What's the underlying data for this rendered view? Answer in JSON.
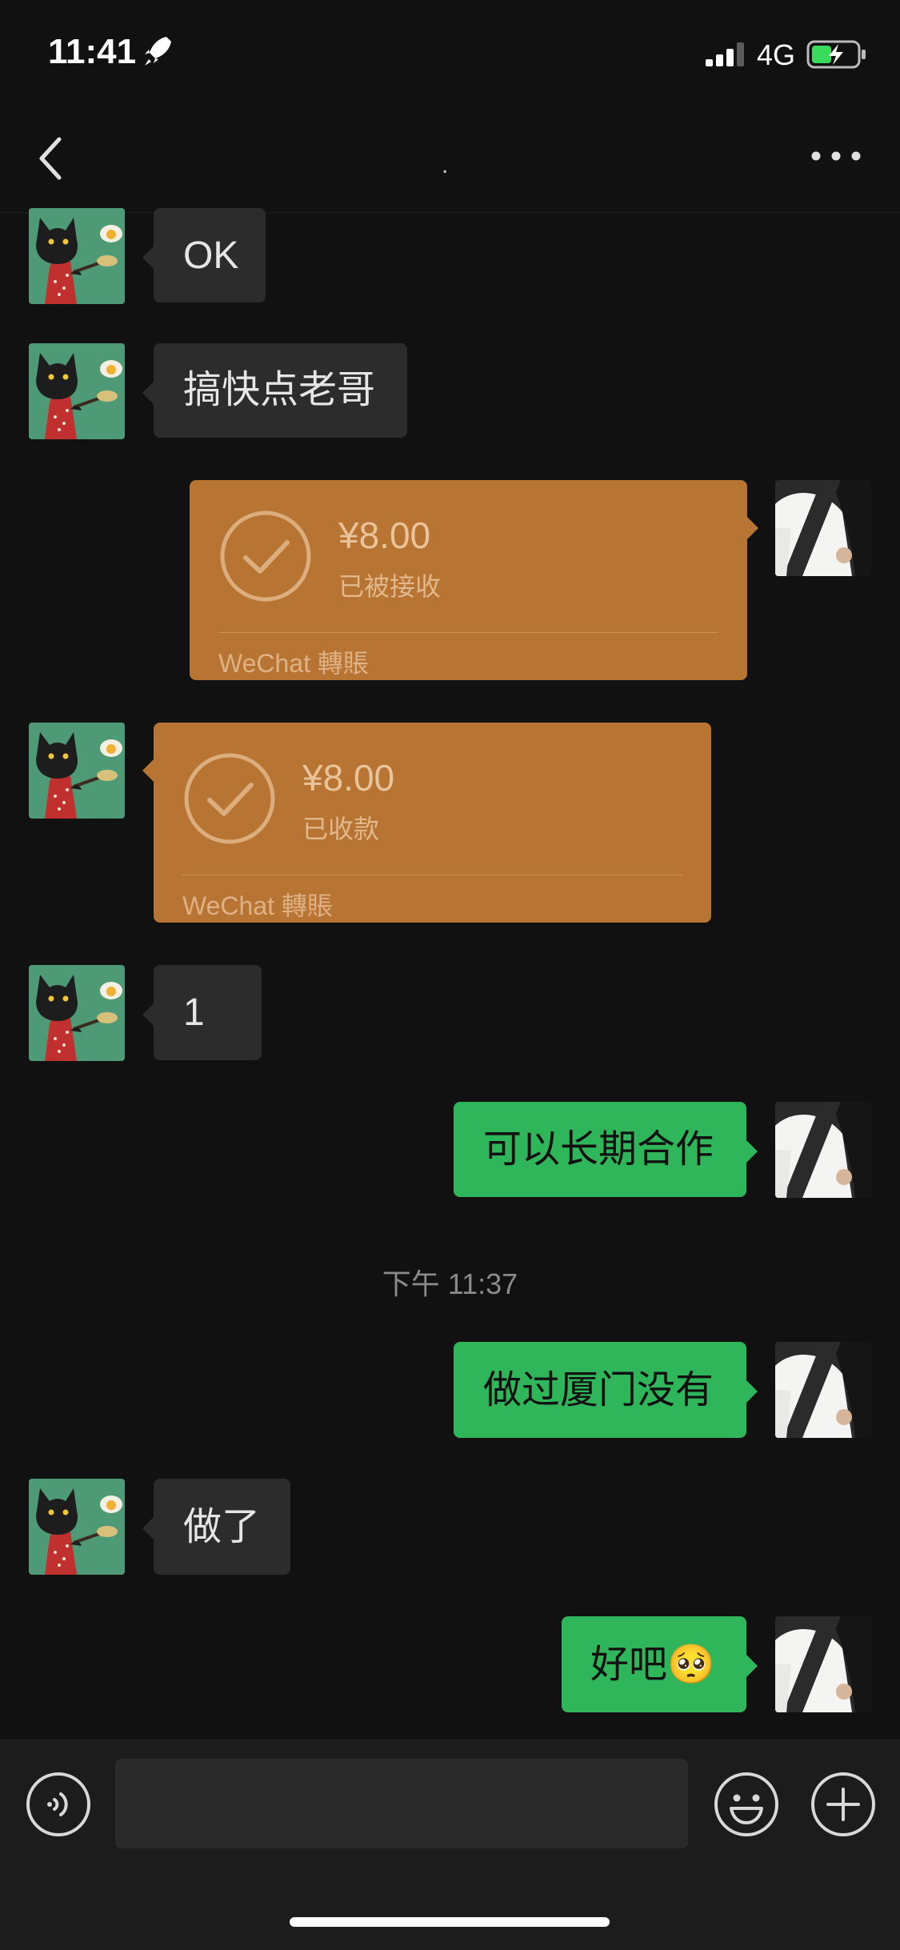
{
  "status_bar": {
    "time": "11:41",
    "network": "4G"
  },
  "nav": {
    "title": "."
  },
  "messages": {
    "m1": "OK",
    "m2": "搞快点老哥",
    "m3": "1",
    "m4": "可以长期合作",
    "m5": "做过厦门没有",
    "m6": "做了",
    "m7": "好吧🥺"
  },
  "transfers": {
    "sent": {
      "amount": "¥8.00",
      "status": "已被接收",
      "brand": "WeChat 轉賬"
    },
    "received": {
      "amount": "¥8.00",
      "status": "已收款",
      "brand": "WeChat 轉賬"
    }
  },
  "timestamp": "下午 11:37",
  "colors": {
    "background": "#111111",
    "incoming_bubble": "#2c2c2c",
    "outgoing_bubble": "#2fb65a",
    "transfer_card": "#b77432"
  },
  "icons": [
    "rocket-icon",
    "signal-icon",
    "battery-charging-icon",
    "back-arrow-icon",
    "more-icon",
    "check-circle-icon",
    "voice-icon",
    "emoji-icon",
    "plus-icon"
  ]
}
